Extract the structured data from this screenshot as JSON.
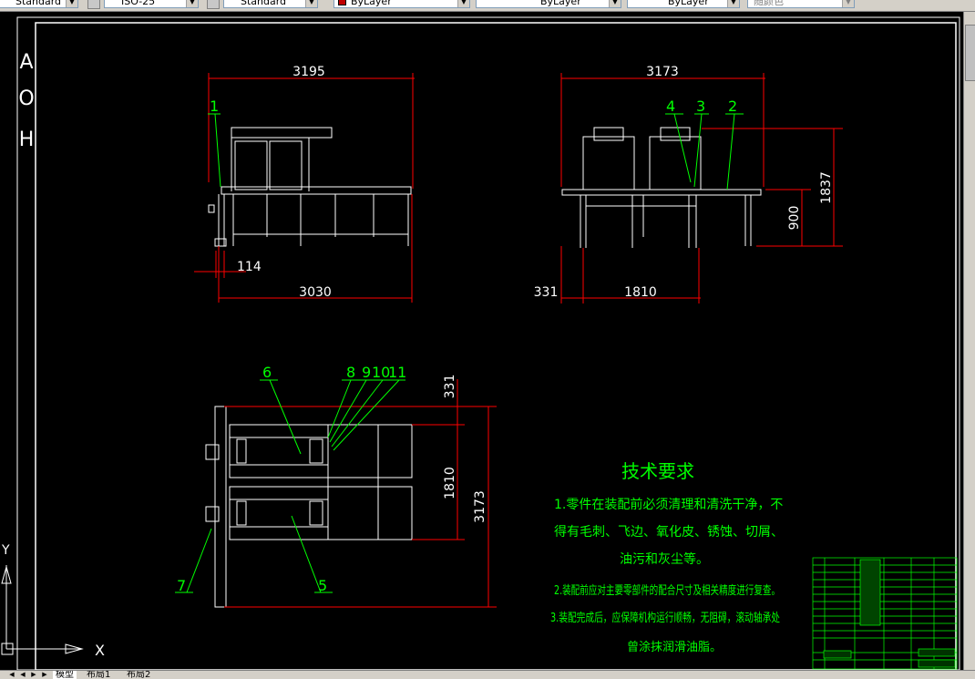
{
  "toolbar": {
    "text_style": "Standard",
    "dim_style": "ISO-25",
    "table_style": "Standard",
    "layer": "ByLayer",
    "linetype": "ByLayer",
    "lineweight": "ByLayer",
    "plot_style": "随颜色"
  },
  "title_side": "AOH",
  "dims": {
    "front_width": "3195",
    "front_bottom": "3030",
    "front_offset": "114",
    "side_width": "3173",
    "side_left": "331",
    "side_inner": "1810",
    "side_height": "1837",
    "side_table": "900",
    "top_331": "331",
    "top_1810": "1810",
    "top_3173": "3173"
  },
  "balloons": {
    "b1": "1",
    "b2": "2",
    "b3": "3",
    "b4": "4",
    "b5": "5",
    "b6": "6",
    "b7": "7",
    "b8": "8",
    "b9": "9",
    "b10": "10",
    "b11": "11"
  },
  "notes": {
    "title": "技术要求",
    "line1": "1.零件在装配前必须清理和清洗干净，不",
    "line2": "得有毛刺、飞边、氧化皮、锈蚀、切屑、",
    "line3": "油污和灰尘等。",
    "line4": "2.装配前应对主要零部件的配合尺寸及相关精度进行复查。",
    "line5": "3.装配完成后，应保障机构运行顺畅，无阻碍，滚动轴承处",
    "line6": "曾涂抹润滑油脂。"
  },
  "ucs": {
    "x": "X",
    "y": "Y"
  },
  "tabs": [
    "模型",
    "布局1",
    "布局2"
  ]
}
